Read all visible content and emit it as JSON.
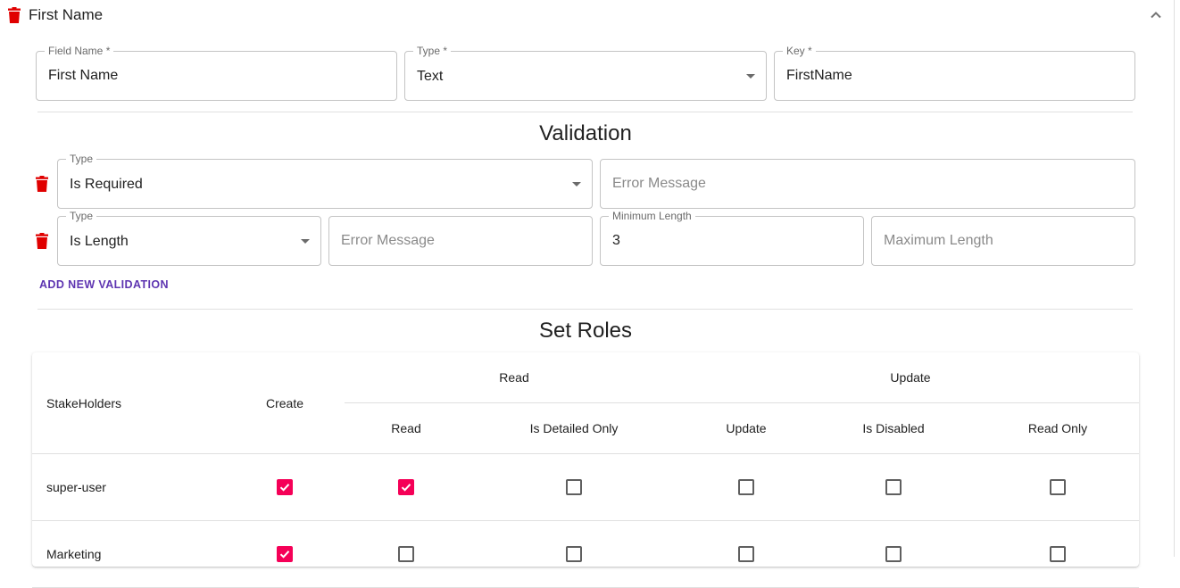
{
  "header": {
    "title": "First Name"
  },
  "fields": {
    "field_name": {
      "label": "Field Name *",
      "value": "First Name"
    },
    "type": {
      "label": "Type *",
      "value": "Text"
    },
    "key": {
      "label": "Key *",
      "value": "FirstName"
    }
  },
  "validation": {
    "title": "Validation",
    "rows": [
      {
        "type_label": "Type",
        "type_value": "Is Required",
        "error_placeholder": "Error Message"
      },
      {
        "type_label": "Type",
        "type_value": "Is Length",
        "error_placeholder": "Error Message",
        "min_label": "Minimum Length",
        "min_value": "3",
        "max_placeholder": "Maximum Length"
      }
    ],
    "add_button": "ADD NEW VALIDATION"
  },
  "roles": {
    "title": "Set Roles",
    "headers": {
      "stakeholders": "StakeHolders",
      "create": "Create",
      "read_group": "Read",
      "update_group": "Update",
      "read": "Read",
      "is_detailed_only": "Is Detailed Only",
      "update": "Update",
      "is_disabled": "Is Disabled",
      "read_only": "Read Only"
    },
    "rows": [
      {
        "name": "super-user",
        "create": true,
        "read": true,
        "is_detailed_only": false,
        "update": false,
        "is_disabled": false,
        "read_only": false
      },
      {
        "name": "Marketing",
        "create": true,
        "read": false,
        "is_detailed_only": false,
        "update": false,
        "is_disabled": false,
        "read_only": false
      }
    ]
  },
  "colors": {
    "delete_icon": "#e00000",
    "checkbox_checked": "#f50057",
    "add_button": "#5e35b1"
  },
  "icons": {
    "delete": "trash-icon",
    "collapse": "chevron-up-icon",
    "dropdown": "caret-down-icon"
  }
}
